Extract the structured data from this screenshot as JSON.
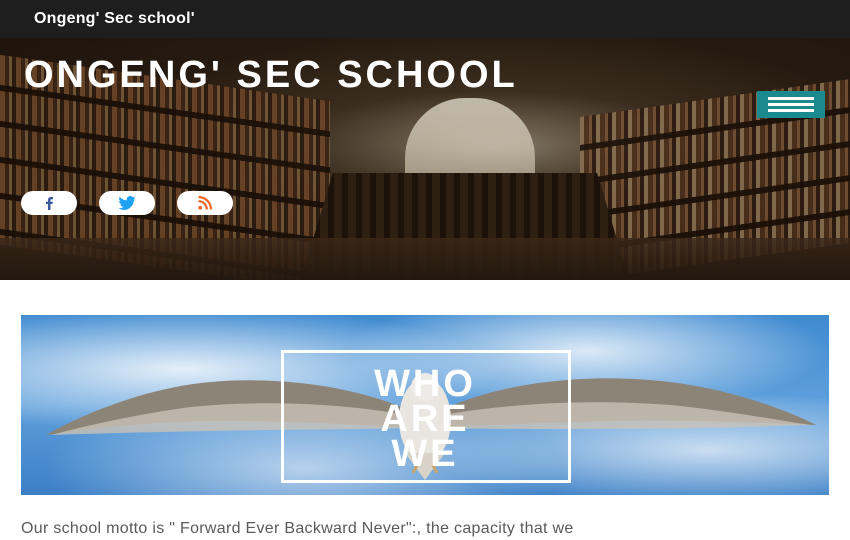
{
  "header": {
    "site_title": "Ongeng' Sec school'"
  },
  "hero": {
    "title": "ONGENG' SEC SCHOOL",
    "menu_icon": "hamburger-menu-icon",
    "social": [
      {
        "name": "facebook",
        "icon": "facebook-icon",
        "color": "#3b5998"
      },
      {
        "name": "twitter",
        "icon": "twitter-icon",
        "color": "#1da1f2"
      },
      {
        "name": "rss",
        "icon": "rss-icon",
        "color": "#f26522"
      }
    ]
  },
  "who": {
    "lines": [
      "WHO",
      "ARE",
      "WE"
    ]
  },
  "motto": "Our school motto is \" Forward Ever Backward Never\":, the capacity that we",
  "colors": {
    "accent": "#1a8a8f",
    "topbar": "#1e1e1e",
    "motto_text": "#5a5a5a"
  }
}
